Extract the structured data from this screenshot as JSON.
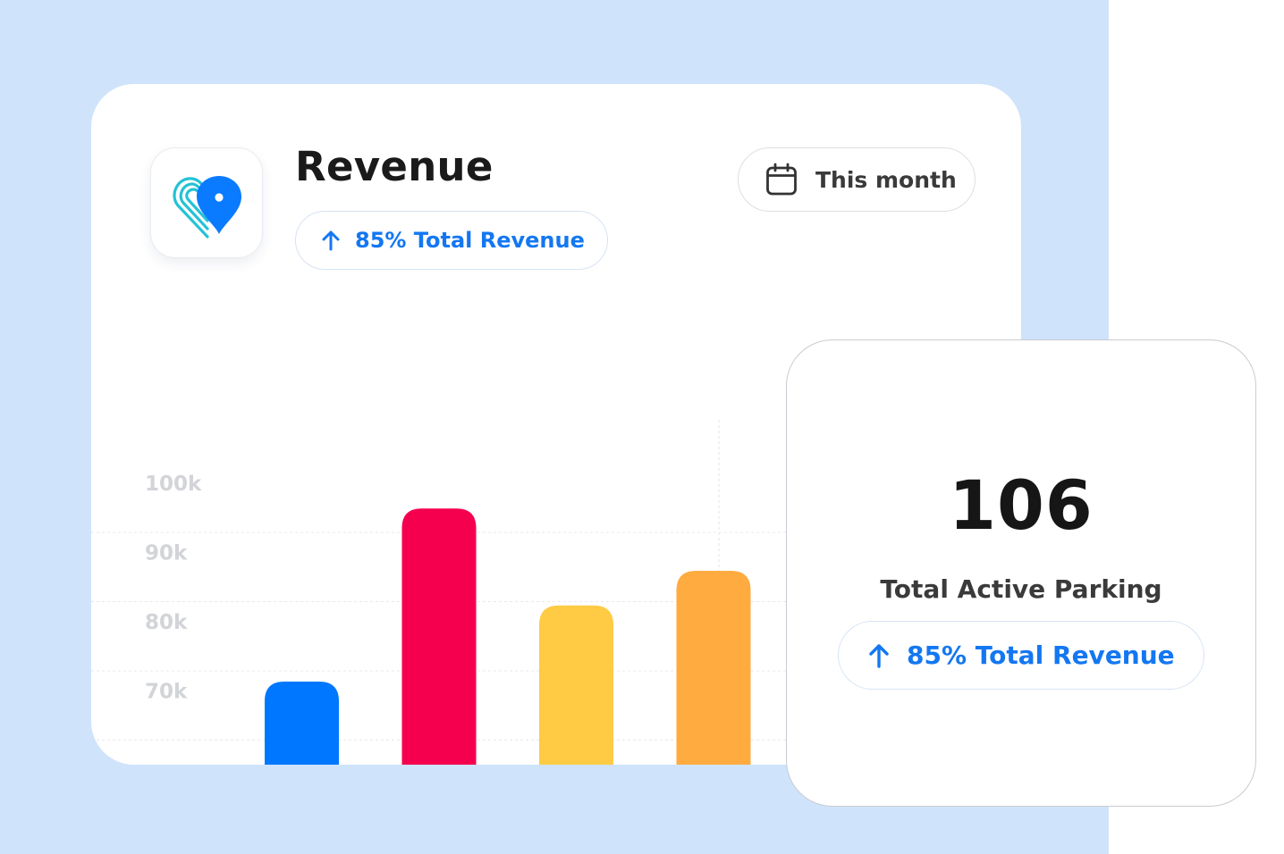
{
  "card": {
    "title": "Revenue",
    "badge": "85% Total Revenue",
    "date_filter": "This month"
  },
  "stat": {
    "value": "106",
    "label": "Total Active Parking",
    "badge": "85% Total Revenue"
  },
  "icons": {
    "logo": "heart-pin-icon",
    "arrow": "arrow-up-icon",
    "calendar": "calendar-icon"
  },
  "colors": {
    "accent": "#1477f2",
    "background": "#cfe3fb",
    "bars": [
      "#0077ff",
      "#f5004f",
      "#ffcb45",
      "#ffab40"
    ]
  },
  "chart_data": {
    "type": "bar",
    "categories": [
      "",
      "",
      "",
      ""
    ],
    "values": [
      72,
      97,
      83,
      88
    ],
    "ylim": [
      60,
      107
    ],
    "y_ticks": [
      70,
      80,
      90,
      100
    ],
    "y_tick_labels": [
      "70k",
      "80k",
      "90k",
      "100k"
    ],
    "grid": true
  }
}
